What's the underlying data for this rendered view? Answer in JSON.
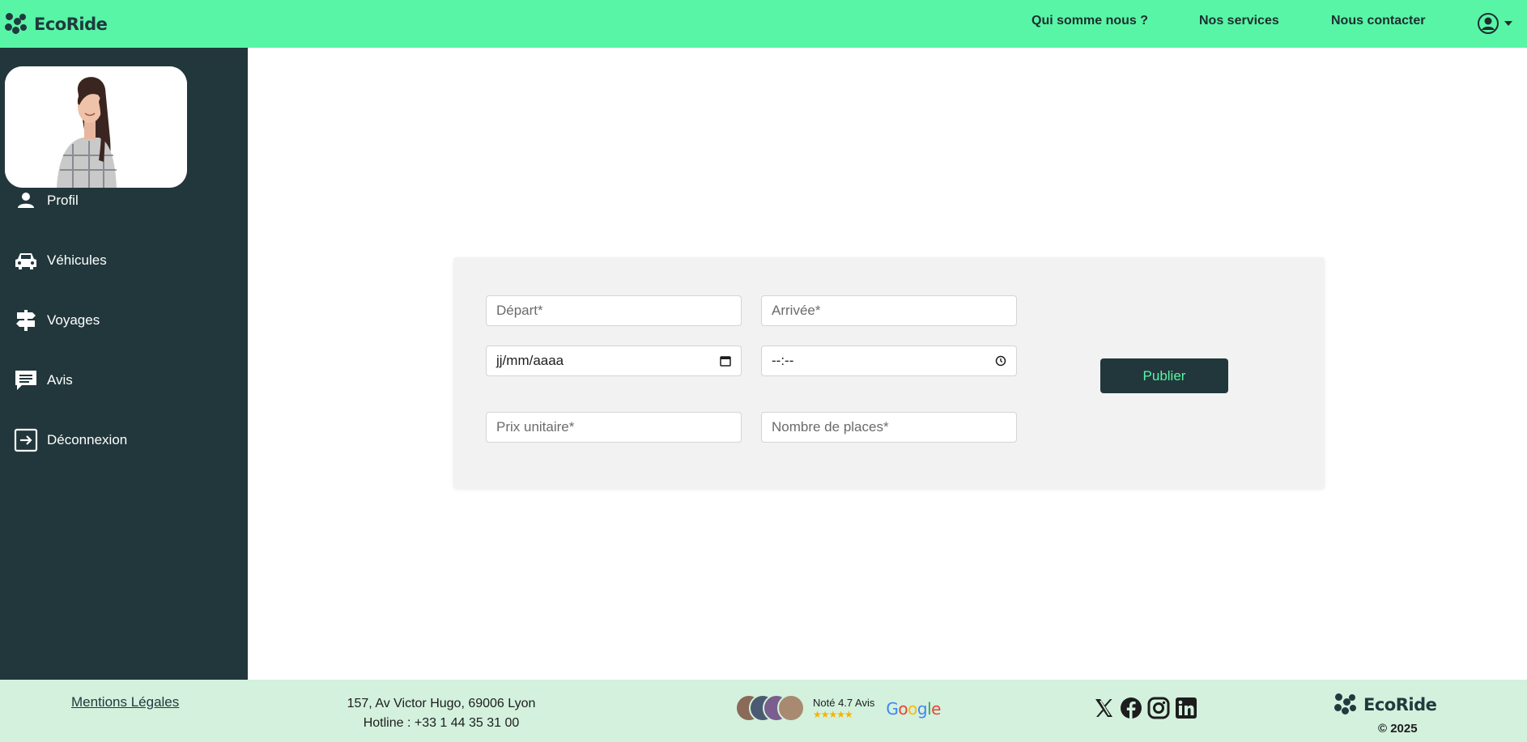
{
  "brand": {
    "name": "EcoRide",
    "icon": "ecoride-logo-icon"
  },
  "header": {
    "nav": [
      "Qui somme nous ?",
      "Nos services",
      "Nous contacter"
    ],
    "user_icon": "user-circle-icon"
  },
  "sidebar": {
    "items": [
      {
        "label": "Profil",
        "icon": "person-icon"
      },
      {
        "label": "Véhicules",
        "icon": "car-icon"
      },
      {
        "label": "Voyages",
        "icon": "signpost-icon"
      },
      {
        "label": "Avis",
        "icon": "chat-icon"
      },
      {
        "label": "Déconnexion",
        "icon": "logout-icon"
      }
    ]
  },
  "form": {
    "depart_placeholder": "Départ*",
    "arrivee_placeholder": "Arrivée*",
    "date_value": "jj/mm/aaaa",
    "time_value": "--:--",
    "prix_placeholder": "Prix unitaire*",
    "places_placeholder": "Nombre de places*",
    "publish_label": "Publier"
  },
  "footer": {
    "legal": "Mentions Légales",
    "address_line1": "157, Av Victor Hugo, 69006 Lyon",
    "address_line2": "Hotline : +33 1 44 35 31 00",
    "rating_text": "Noté 4.7 Avis",
    "stars": "★★★★★",
    "google": "Google",
    "copyright": "© 2025"
  },
  "colors": {
    "accent": "#58f5a6",
    "dark": "#21373b",
    "footer_bg": "#d3f1dd",
    "card_bg": "#f2f2f2"
  }
}
